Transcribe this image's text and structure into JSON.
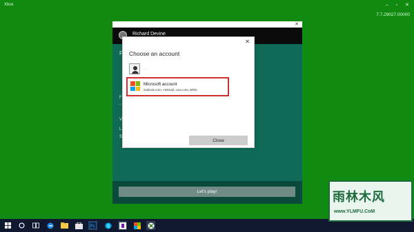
{
  "window": {
    "title": "Xbox",
    "version": "7.7.29027.00000"
  },
  "profile": {
    "name": "Richard Devine"
  },
  "panel": {
    "play_label": "Let's play!",
    "ghost_letters": [
      "F",
      "-",
      "V",
      "L",
      "S"
    ]
  },
  "dialog": {
    "title": "Choose an account",
    "placeholder_dots": "· ·",
    "account": {
      "name": "Microsoft account",
      "subtitle": "Outlook.com, Hotmail, Live.com, MSN"
    },
    "close_label": "Close",
    "x_glyph": "✕"
  },
  "taskbar": {
    "icons": [
      "windows-start",
      "search",
      "task-view",
      "edge",
      "file-explorer",
      "store",
      "photoshop",
      "people",
      "skype",
      "onenote",
      "xbox-store",
      "xbox"
    ]
  },
  "watermark": {
    "text_cn": "雨林木风",
    "url": "www.YLMFU.CoM"
  }
}
